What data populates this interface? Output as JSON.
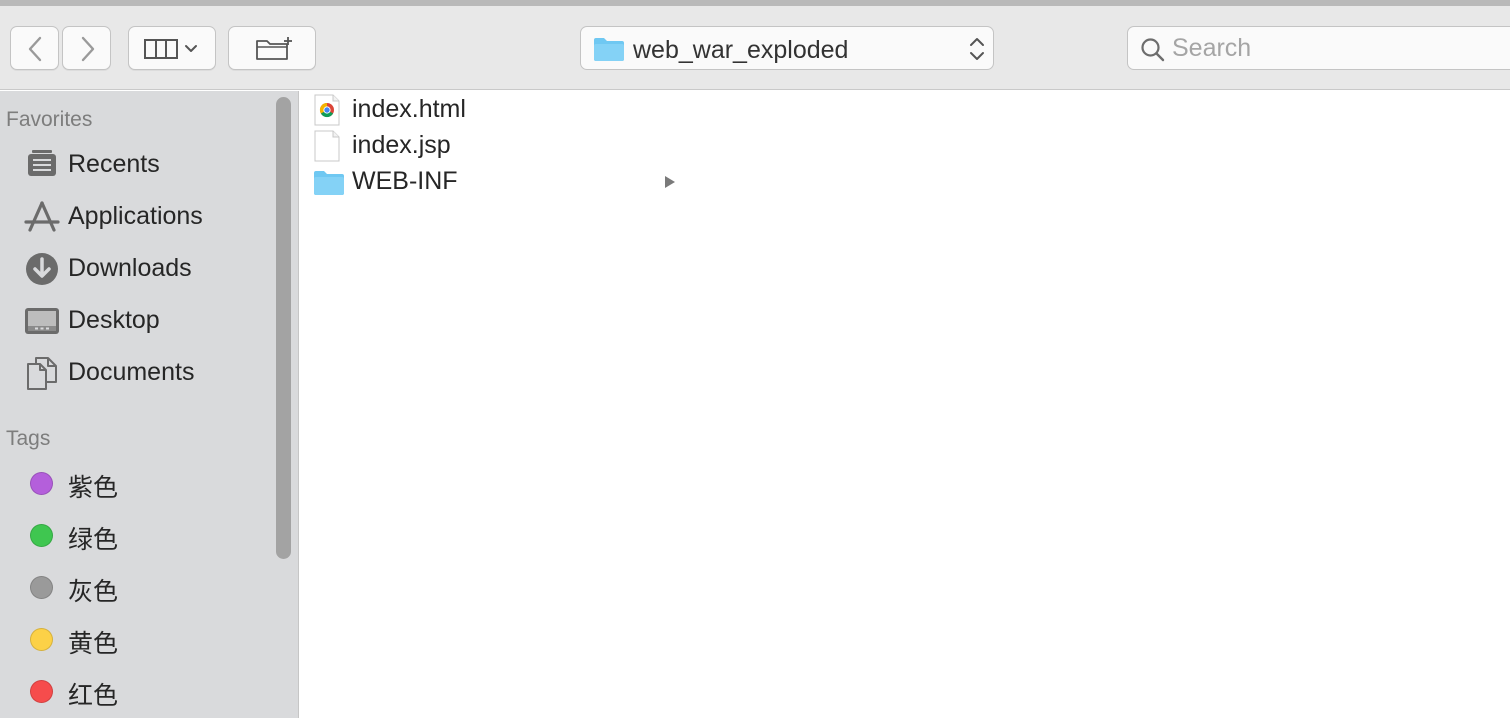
{
  "toolbar": {
    "back_icon": "chevron-left-icon",
    "forward_icon": "chevron-right-icon",
    "view_icon": "columns-view-icon",
    "new_folder_icon": "new-folder-icon",
    "path_folder": "web_war_exploded",
    "search_placeholder": "Search"
  },
  "sidebar": {
    "favorites_header": "Favorites",
    "favorites": [
      {
        "label": "Recents",
        "icon": "recents-icon"
      },
      {
        "label": "Applications",
        "icon": "applications-icon"
      },
      {
        "label": "Downloads",
        "icon": "downloads-icon"
      },
      {
        "label": "Desktop",
        "icon": "desktop-icon"
      },
      {
        "label": "Documents",
        "icon": "documents-icon"
      }
    ],
    "tags_header": "Tags",
    "tags": [
      {
        "label": "紫色",
        "color": "#b45fdb"
      },
      {
        "label": "绿色",
        "color": "#3fc650"
      },
      {
        "label": "灰色",
        "color": "#9a9a9a"
      },
      {
        "label": "黄色",
        "color": "#fcd147"
      },
      {
        "label": "红色",
        "color": "#f64c4c"
      }
    ]
  },
  "files": [
    {
      "name": "index.html",
      "icon": "chrome-document-icon"
    },
    {
      "name": "index.jsp",
      "icon": "blank-document-icon"
    },
    {
      "name": "WEB-INF",
      "icon": "folder-icon",
      "has_children": true
    }
  ],
  "colors": {
    "folder": "#6fc8f2",
    "accent": "#1e88e5"
  }
}
